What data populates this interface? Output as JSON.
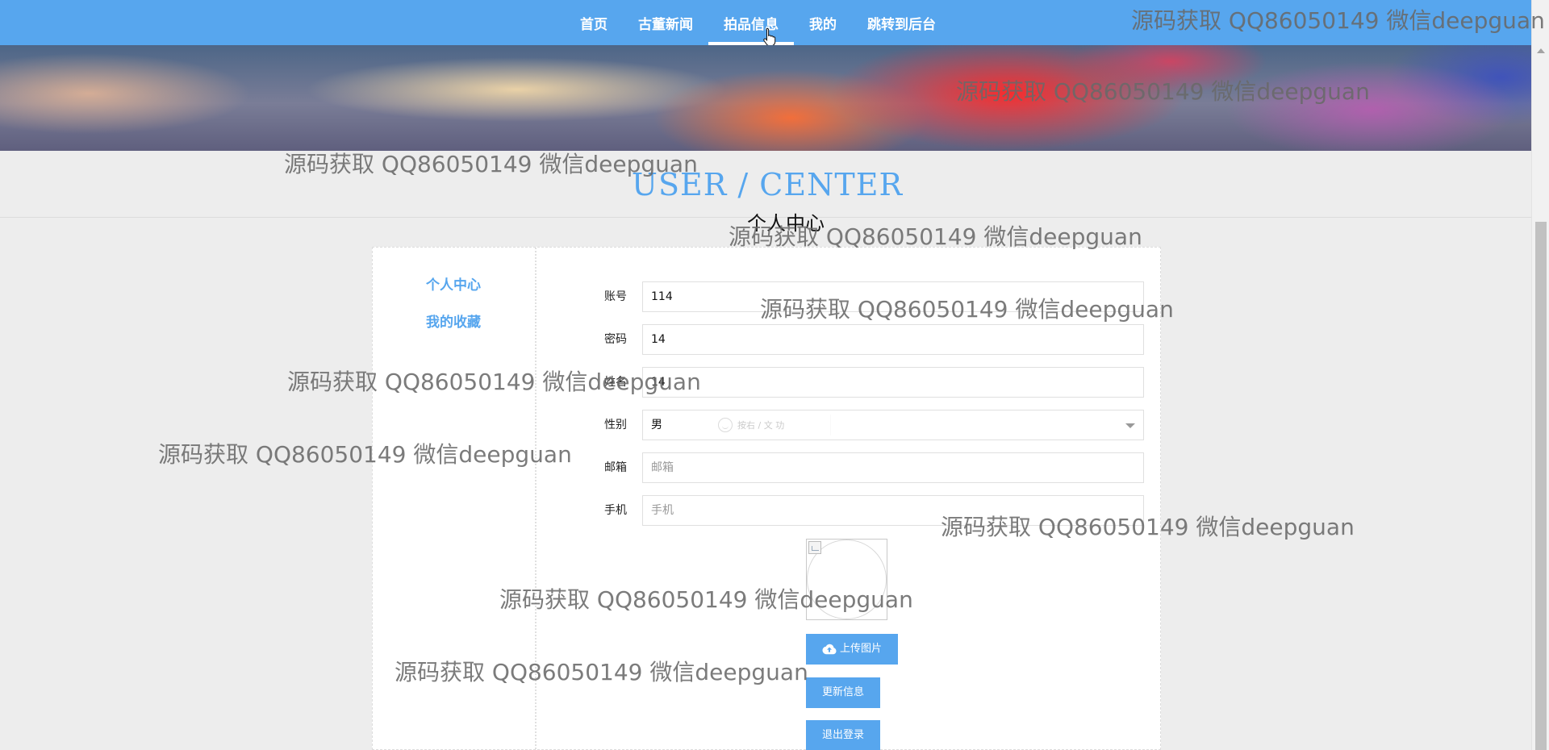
{
  "nav": {
    "items": [
      {
        "label": "首页"
      },
      {
        "label": "古董新闻"
      },
      {
        "label": "拍品信息",
        "active": true
      },
      {
        "label": "我的"
      },
      {
        "label": "跳转到后台"
      }
    ]
  },
  "section": {
    "title": "USER / CENTER",
    "subtitle": "个人中心"
  },
  "sidebar": {
    "items": [
      {
        "label": "个人中心"
      },
      {
        "label": "我的收藏"
      }
    ]
  },
  "form": {
    "account": {
      "label": "账号",
      "value": "114"
    },
    "password": {
      "label": "密码",
      "value": "14"
    },
    "name": {
      "label": "姓名",
      "value": "14"
    },
    "gender": {
      "label": "性别",
      "value": "男"
    },
    "email": {
      "label": "邮箱",
      "value": "",
      "placeholder": "邮箱"
    },
    "phone": {
      "label": "手机",
      "value": "",
      "placeholder": "手机"
    },
    "select_overlay_text": "按右 / 文 功"
  },
  "buttons": {
    "upload": "上传图片",
    "update": "更新信息",
    "logout": "退出登录"
  },
  "watermark": "源码获取 QQ86050149 微信deepguan",
  "colors": {
    "primary": "#57a6ee",
    "background": "#ededed",
    "panel": "#ffffff"
  },
  "icons": [
    "cursor-hand-icon",
    "cloud-upload-icon",
    "chevron-down-icon",
    "broken-image-icon"
  ]
}
